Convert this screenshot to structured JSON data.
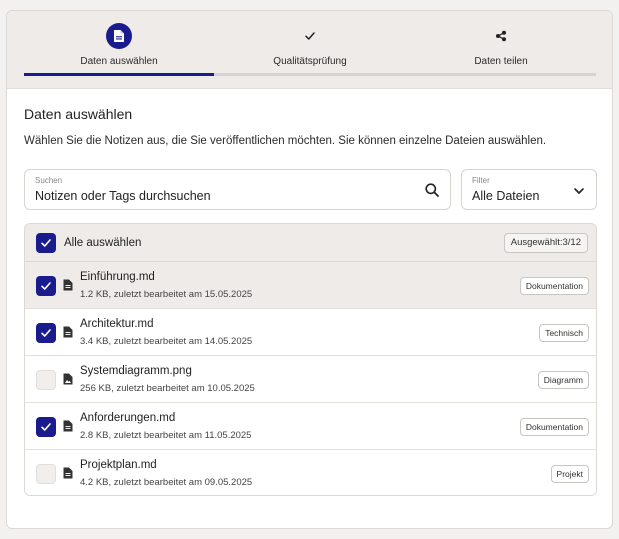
{
  "stepper": {
    "steps": [
      {
        "label": "Daten auswählen",
        "icon": "document-icon",
        "state": "active"
      },
      {
        "label": "Qualitätsprüfung",
        "icon": "check-icon",
        "state": "pending"
      },
      {
        "label": "Daten teilen",
        "icon": "share-icon",
        "state": "pending"
      }
    ]
  },
  "page": {
    "title": "Daten auswählen",
    "description": "Wählen Sie die Notizen aus, die Sie veröffentlichen möchten. Sie können einzelne Dateien auswählen."
  },
  "search": {
    "caption": "Suchen",
    "placeholder": "Notizen oder Tags durchsuchen"
  },
  "filter": {
    "caption": "Filter",
    "selected": "Alle Dateien"
  },
  "list": {
    "select_all_label": "Alle auswählen",
    "select_all_checked": true,
    "selected_count": "Ausgewählt:3/12",
    "files": [
      {
        "name": "Einführung.md",
        "meta": "1.2 KB, zuletzt bearbeitet am 15.05.2025",
        "tag": "Dokumentation",
        "checked": true,
        "icon": "document-icon"
      },
      {
        "name": "Architektur.md",
        "meta": "3.4 KB, zuletzt bearbeitet am 14.05.2025",
        "tag": "Technisch",
        "checked": true,
        "icon": "document-icon"
      },
      {
        "name": "Systemdiagramm.png",
        "meta": "256 KB, zuletzt bearbeitet am 10.05.2025",
        "tag": "Diagramm",
        "checked": false,
        "icon": "image-file-icon"
      },
      {
        "name": "Anforderungen.md",
        "meta": "2.8 KB, zuletzt bearbeitet am 11.05.2025",
        "tag": "Dokumentation",
        "checked": true,
        "icon": "document-icon"
      },
      {
        "name": "Projektplan.md",
        "meta": "4.2 KB, zuletzt bearbeitet am 09.05.2025",
        "tag": "Projekt",
        "checked": false,
        "icon": "document-icon"
      }
    ]
  },
  "colors": {
    "accent": "#1a1b8c",
    "surface": "#efebe8",
    "border": "#dcd8d4"
  }
}
